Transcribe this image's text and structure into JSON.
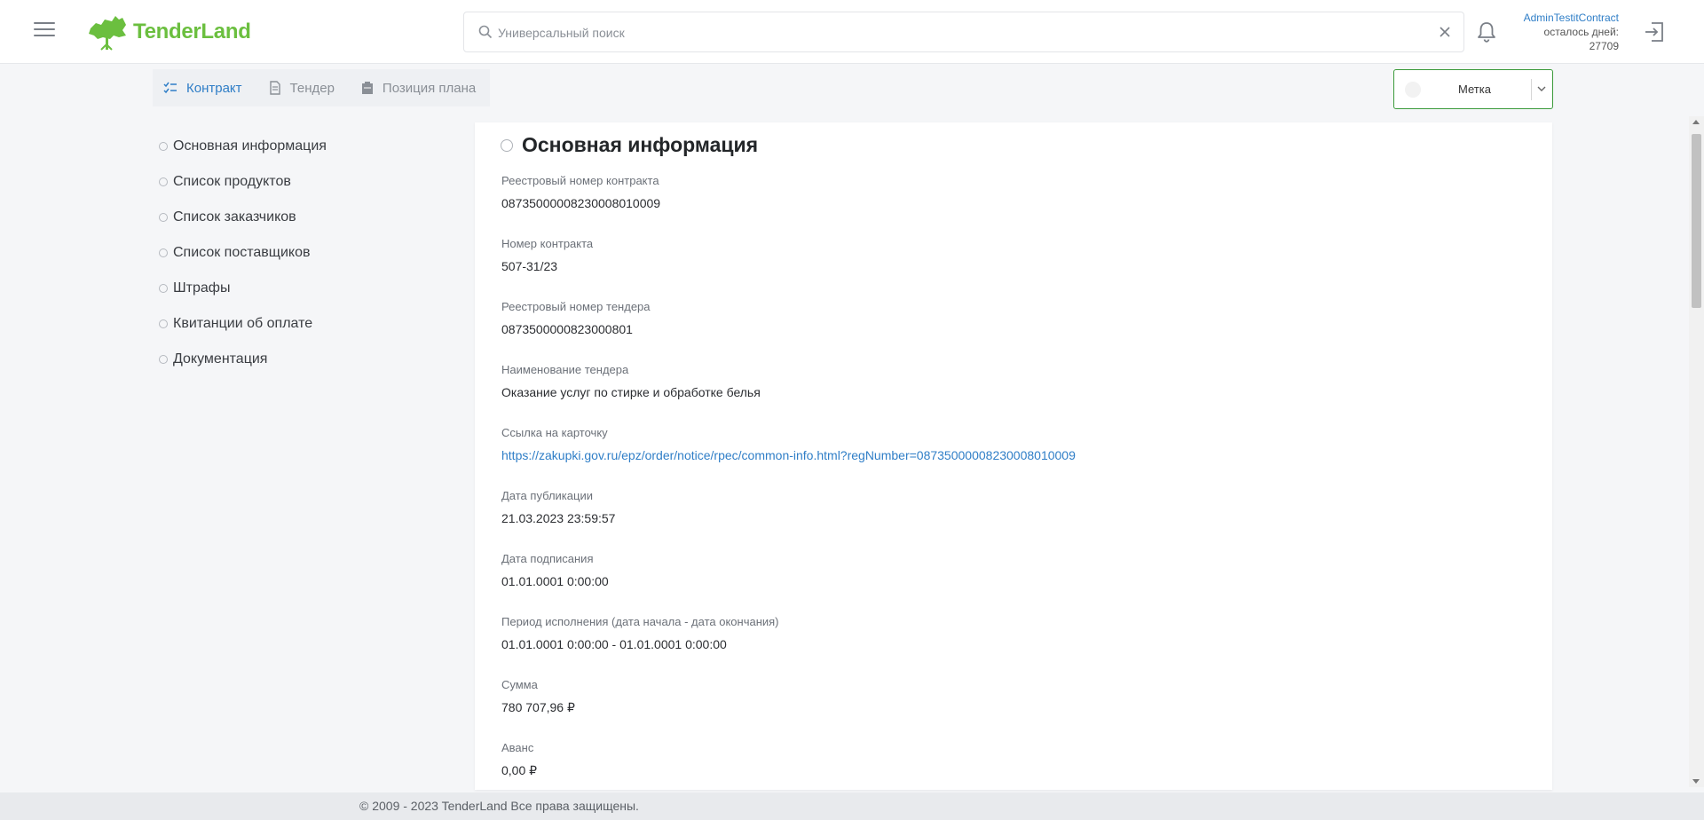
{
  "brand": {
    "name": "TenderLand",
    "color": "#6bbf3f"
  },
  "header": {
    "search_placeholder": "Универсальный поиск",
    "user_name": "AdminTestitContract",
    "days_label": "осталось дней:",
    "days_value": "27709"
  },
  "tabs": [
    {
      "label": "Контракт",
      "icon": "checklist-icon",
      "active": true
    },
    {
      "label": "Тендер",
      "icon": "document-icon",
      "active": false
    },
    {
      "label": "Позиция плана",
      "icon": "clipboard-icon",
      "active": false
    }
  ],
  "label_select": {
    "value": "Метка",
    "border_color": "#3a9a3a"
  },
  "sidebar": {
    "items": [
      {
        "label": "Основная информация"
      },
      {
        "label": "Список продуктов"
      },
      {
        "label": "Список заказчиков"
      },
      {
        "label": "Список поставщиков"
      },
      {
        "label": "Штрафы"
      },
      {
        "label": "Квитанции об оплате"
      },
      {
        "label": "Документация"
      }
    ]
  },
  "main": {
    "title": "Основная информация",
    "fields": [
      {
        "label": "Реестровый номер контракта",
        "value": "0873500000823000801000 9"
      },
      {
        "label": "Номер контракта",
        "value": "507-31/23"
      },
      {
        "label": "Реестровый номер тендера",
        "value": "0873500000823000801"
      },
      {
        "label": "Наименование тендера",
        "value": "Оказание услуг по стирке и обработке белья"
      },
      {
        "label": "Ссылка на карточку",
        "value": "https://zakupki.gov.ru/epz/order/notice/rpec/common-info.html?regNumber=08735000008230008010009",
        "link": true
      },
      {
        "label": "Дата публикации",
        "value": "21.03.2023 23:59:57"
      },
      {
        "label": "Дата подписания",
        "value": "01.01.0001 0:00:00"
      },
      {
        "label": "Период исполнения (дата начала - дата окончания)",
        "value": "01.01.0001 0:00:00 - 01.01.0001 0:00:00"
      },
      {
        "label": "Сумма",
        "value": "780 707,96 ₽"
      },
      {
        "label": "Аванс",
        "value": "0,00 ₽"
      }
    ]
  },
  "footer": {
    "text": "© 2009 - 2023 TenderLand Все права защищены."
  },
  "colors": {
    "accent": "#2f7ec7",
    "background": "#f5f6f8"
  }
}
